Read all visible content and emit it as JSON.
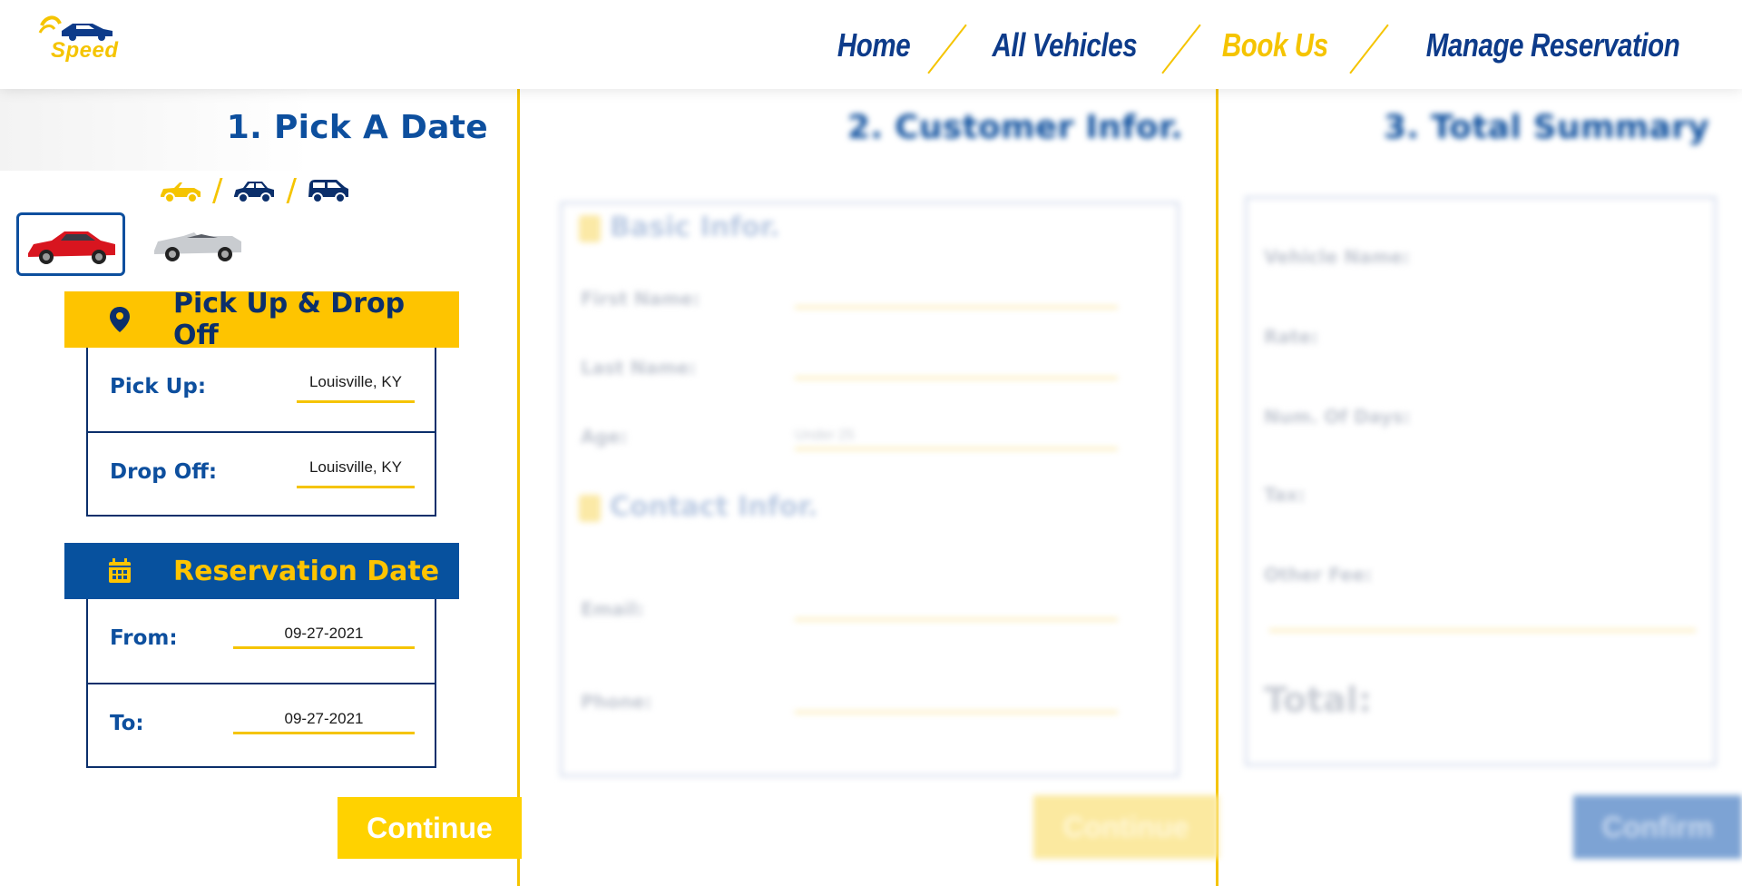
{
  "brand": {
    "logo_text": "Speed"
  },
  "nav": {
    "items": [
      {
        "label": "Home",
        "active": false
      },
      {
        "label": "All Vehicles",
        "active": false
      },
      {
        "label": "Book Us",
        "active": true
      },
      {
        "label": "Manage Reservation",
        "active": false
      }
    ]
  },
  "step1": {
    "title": "1. Pick A Date",
    "vehicle_types": [
      "convertible-icon",
      "sedan-icon",
      "suv-icon"
    ],
    "type_separator": "/",
    "thumbnails": [
      {
        "name": "red-sports-car-thumbnail",
        "selected": true
      },
      {
        "name": "silver-convertible-thumbnail",
        "selected": false
      }
    ],
    "pickup_card": {
      "title": "Pick Up & Drop Off",
      "pickup_label": "Pick Up:",
      "pickup_value": "Louisville, KY",
      "dropoff_label": "Drop Off:",
      "dropoff_value": "Louisville, KY"
    },
    "date_card": {
      "title": "Reservation Date",
      "from_label": "From:",
      "from_value": "09-27-2021",
      "to_label": "To:",
      "to_value": "09-27-2021"
    },
    "continue_label": "Continue"
  },
  "step2": {
    "title": "2. Customer Infor.",
    "basic_title": "Basic Infor.",
    "first_name_label": "First Name:",
    "last_name_label": "Last Name:",
    "age_label": "Age:",
    "age_placeholder": "Under 25",
    "contact_title": "Contact Infor.",
    "email_label": "Email:",
    "phone_label": "Phone:",
    "continue_label": "Continue"
  },
  "step3": {
    "title": "3. Total Summary",
    "vehicle_name_label": "Vehicle Name:",
    "rate_label": "Rate:",
    "num_days_label": "Num. Of Days:",
    "tax_label": "Tax:",
    "other_fee_label": "Other Fee:",
    "total_label": "Total:",
    "confirm_label": "Confirm"
  },
  "colors": {
    "primary_blue": "#07519e",
    "dark_navy": "#0b2f6b",
    "accent_yellow": "#fec400"
  }
}
